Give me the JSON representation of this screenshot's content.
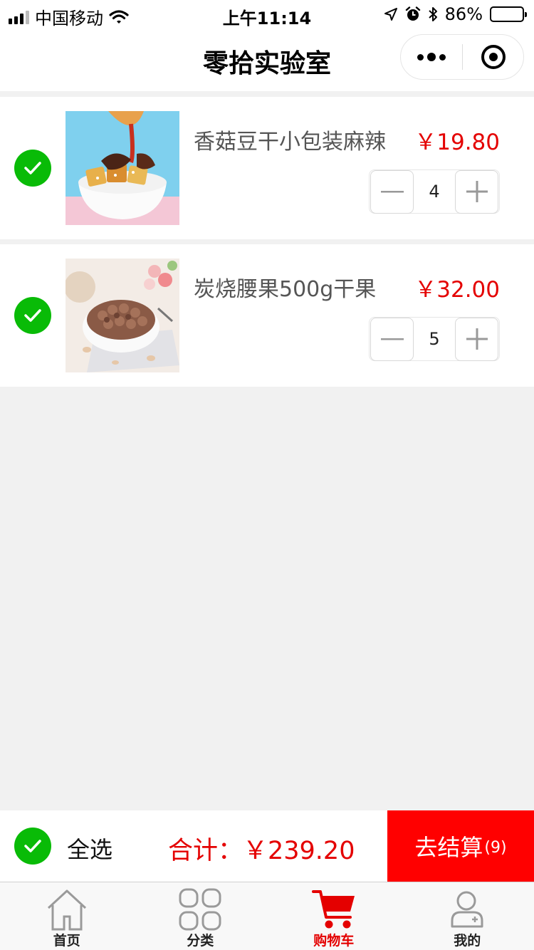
{
  "status_bar": {
    "carrier": "中国移动",
    "time": "上午11:14",
    "battery": "86%",
    "battery_level": 0.86
  },
  "nav": {
    "title": "零拾实验室"
  },
  "cart": {
    "items": [
      {
        "name": "香菇豆干小包装麻辣",
        "price": "￥19.80",
        "qty": "4",
        "checked": true
      },
      {
        "name": "炭烧腰果500g干果",
        "price": "￥32.00",
        "qty": "5",
        "checked": true
      }
    ]
  },
  "footer": {
    "select_all": "全选",
    "total": "合计：￥239.20",
    "checkout": "去结算",
    "checkout_count": "(9)"
  },
  "tabbar": {
    "items": [
      {
        "label": "首页",
        "icon": "home-icon"
      },
      {
        "label": "分类",
        "icon": "category-grid-icon"
      },
      {
        "label": "购物车",
        "icon": "cart-icon"
      },
      {
        "label": "我的",
        "icon": "profile-icon"
      }
    ],
    "active_index": 2
  },
  "colors": {
    "accent_red": "#e40000",
    "checkout_red": "#ff0000",
    "check_green": "#09bb07",
    "background": "#f1f1f1"
  }
}
